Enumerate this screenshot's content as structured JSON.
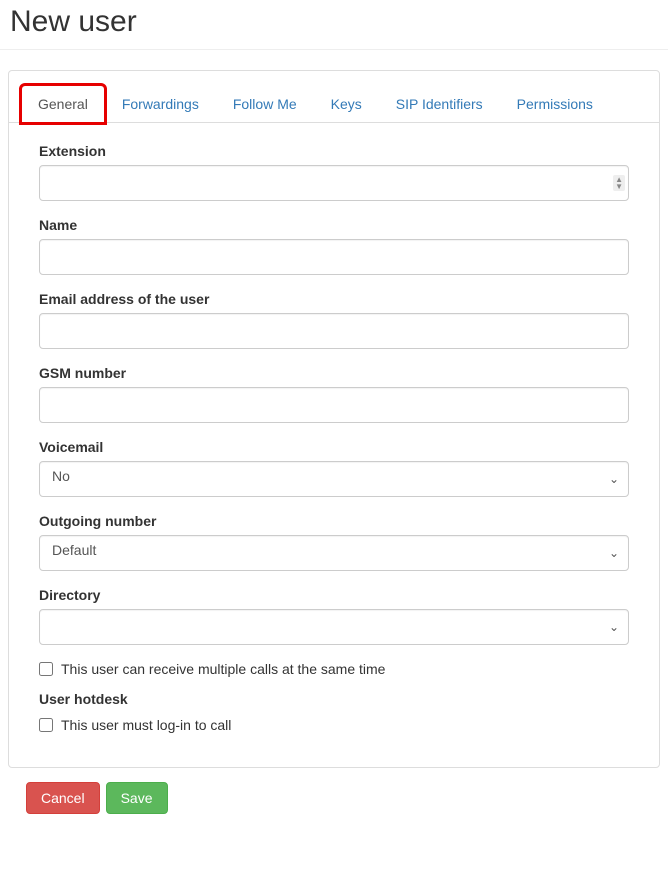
{
  "header": {
    "title": "New user"
  },
  "tabs": [
    {
      "label": "General",
      "active": true,
      "highlight": true
    },
    {
      "label": "Forwardings",
      "active": false
    },
    {
      "label": "Follow Me",
      "active": false
    },
    {
      "label": "Keys",
      "active": false
    },
    {
      "label": "SIP Identifiers",
      "active": false
    },
    {
      "label": "Permissions",
      "active": false
    }
  ],
  "form": {
    "extension": {
      "label": "Extension",
      "value": ""
    },
    "name": {
      "label": "Name",
      "value": ""
    },
    "email": {
      "label": "Email address of the user",
      "value": ""
    },
    "gsm": {
      "label": "GSM number",
      "value": ""
    },
    "voicemail": {
      "label": "Voicemail",
      "value": "No"
    },
    "outgoing": {
      "label": "Outgoing number",
      "value": "Default"
    },
    "directory": {
      "label": "Directory",
      "value": ""
    },
    "multicalls": {
      "label": "This user can receive multiple calls at the same time",
      "checked": false
    },
    "hotdesk_section": "User hotdesk",
    "hotdesk_login": {
      "label": "This user must log-in to call",
      "checked": false
    }
  },
  "actions": {
    "cancel": "Cancel",
    "save": "Save"
  }
}
